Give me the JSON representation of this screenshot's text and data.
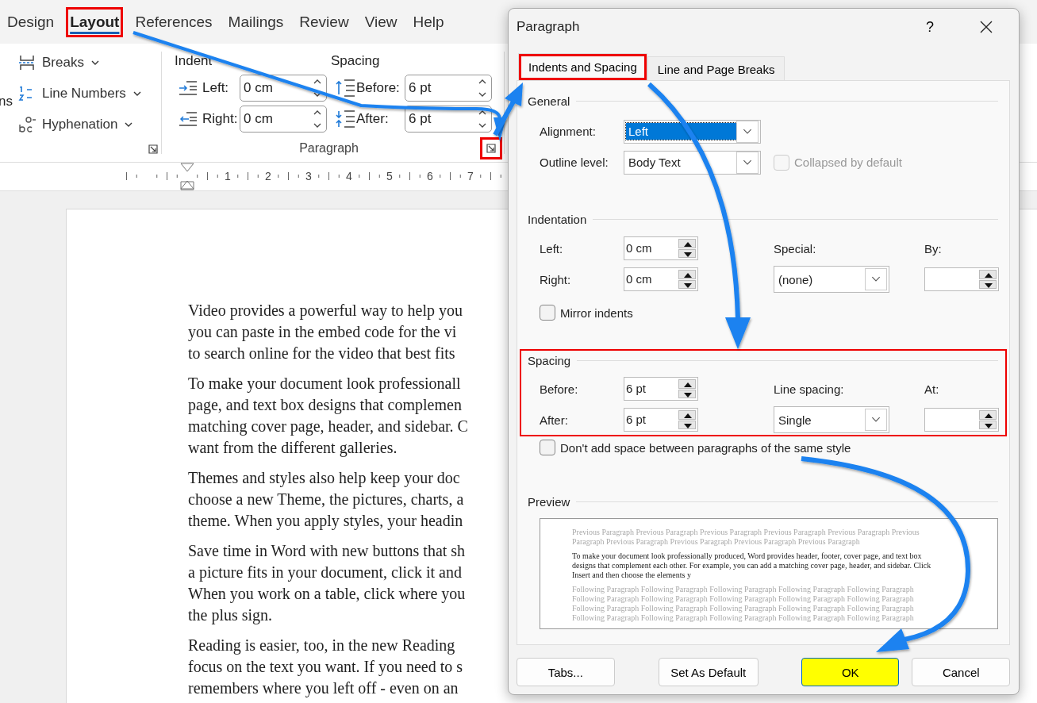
{
  "word": {
    "tabs": [
      {
        "label": "Design",
        "selected": false,
        "highlighted": false
      },
      {
        "label": "Layout",
        "selected": true,
        "highlighted": true
      },
      {
        "label": "References",
        "selected": false,
        "highlighted": false
      },
      {
        "label": "Mailings",
        "selected": false,
        "highlighted": false
      },
      {
        "label": "Review",
        "selected": false,
        "highlighted": false
      },
      {
        "label": "View",
        "selected": false,
        "highlighted": false
      },
      {
        "label": "Help",
        "selected": false,
        "highlighted": false
      }
    ],
    "ribbon": {
      "cut_label": "ns",
      "page_setup": [
        {
          "kind": "breaks",
          "label": "Breaks"
        },
        {
          "kind": "line_numbers",
          "label": "Line Numbers"
        },
        {
          "kind": "hyphenation",
          "label": "Hyphenation"
        }
      ],
      "paragraph": {
        "title": "Paragraph",
        "indent_heading": "Indent",
        "spacing_heading": "Spacing",
        "launcher_highlighted": true,
        "rows": [
          {
            "indent_label": "Left:",
            "indent_value": "0 cm",
            "spacing_label": "Before:",
            "spacing_value": "6 pt"
          },
          {
            "indent_label": "Right:",
            "indent_value": "0 cm",
            "spacing_label": "After:",
            "spacing_value": "6 pt"
          }
        ]
      }
    },
    "ruler": {
      "numbers": [
        "1",
        "2",
        "3",
        "4",
        "5",
        "6",
        "7"
      ]
    },
    "document": {
      "paragraphs": [
        [
          "Video provides a powerful way to help you",
          "you can paste in the embed code for the vi",
          "to search online for the video that best fits"
        ],
        [
          "To make your document look professionall",
          "page, and text box designs that complemen",
          "matching cover page, header, and sidebar. C",
          "want from the different galleries."
        ],
        [
          "Themes and styles also help keep your doc",
          "choose a new Theme, the pictures, charts, a",
          "theme. When you apply styles, your headin"
        ],
        [
          "Save time in Word with new buttons that sh",
          "a picture fits in your document, click it and",
          "When you work on a table, click where you",
          "the plus sign."
        ],
        [
          "Reading is easier, too, in the new Reading",
          "focus on the text you want. If you need to s",
          "remembers where you left off - even on an"
        ]
      ]
    }
  },
  "dialog": {
    "title": "Paragraph",
    "help": "?",
    "tabs": [
      {
        "label": "Indents and Spacing",
        "selected": true,
        "highlighted": true
      },
      {
        "label": "Line and Page Breaks",
        "selected": false,
        "highlighted": false
      }
    ],
    "general": {
      "heading": "General",
      "alignment": {
        "label": "Alignment:",
        "value": "Left",
        "focused": true
      },
      "outline_level": {
        "label": "Outline level:",
        "value": "Body Text",
        "focused": false
      },
      "collapsed": {
        "label": "Collapsed by default",
        "checked": false,
        "disabled": true
      }
    },
    "indentation": {
      "heading": "Indentation",
      "left": {
        "label": "Left:",
        "value": "0 cm"
      },
      "right": {
        "label": "Right:",
        "value": "0 cm"
      },
      "special": {
        "label": "Special:",
        "value": "(none)"
      },
      "by": {
        "label": "By:"
      },
      "mirror": {
        "label": "Mirror indents",
        "checked": false,
        "disabled": false
      }
    },
    "spacing": {
      "heading": "Spacing",
      "highlighted": true,
      "before": {
        "label": "Before:",
        "value": "6 pt"
      },
      "after": {
        "label": "After:",
        "value": "6 pt"
      },
      "line_spacing": {
        "label": "Line spacing:",
        "value": "Single"
      },
      "at": {
        "label": "At:"
      },
      "dont_add": {
        "label": "Don't add space between paragraphs of the same style",
        "checked": false,
        "disabled": false
      }
    },
    "preview": {
      "heading": "Preview",
      "previous": "Previous Paragraph Previous Paragraph Previous Paragraph Previous Paragraph Previous Paragraph Previous Paragraph Previous Paragraph Previous Paragraph Previous Paragraph Previous Paragraph",
      "current": "To make your document look professionally produced, Word provides header, footer, cover page, and text box designs that complement each other. For example, you can add a matching cover page, header, and sidebar. Click Insert and then choose the elements y",
      "following": "Following Paragraph Following Paragraph Following Paragraph Following Paragraph Following Paragraph Following Paragraph Following Paragraph Following Paragraph Following Paragraph Following Paragraph Following Paragraph Following Paragraph Following Paragraph Following Paragraph Following Paragraph Following Paragraph Following Paragraph Following Paragraph Following Paragraph Following Paragraph"
    },
    "buttons": [
      {
        "label": "Tabs...",
        "highlighted": false
      },
      {
        "label": "Set As Default",
        "highlighted": false
      },
      {
        "label": "OK",
        "highlighted": true
      },
      {
        "label": "Cancel",
        "highlighted": false
      }
    ]
  }
}
